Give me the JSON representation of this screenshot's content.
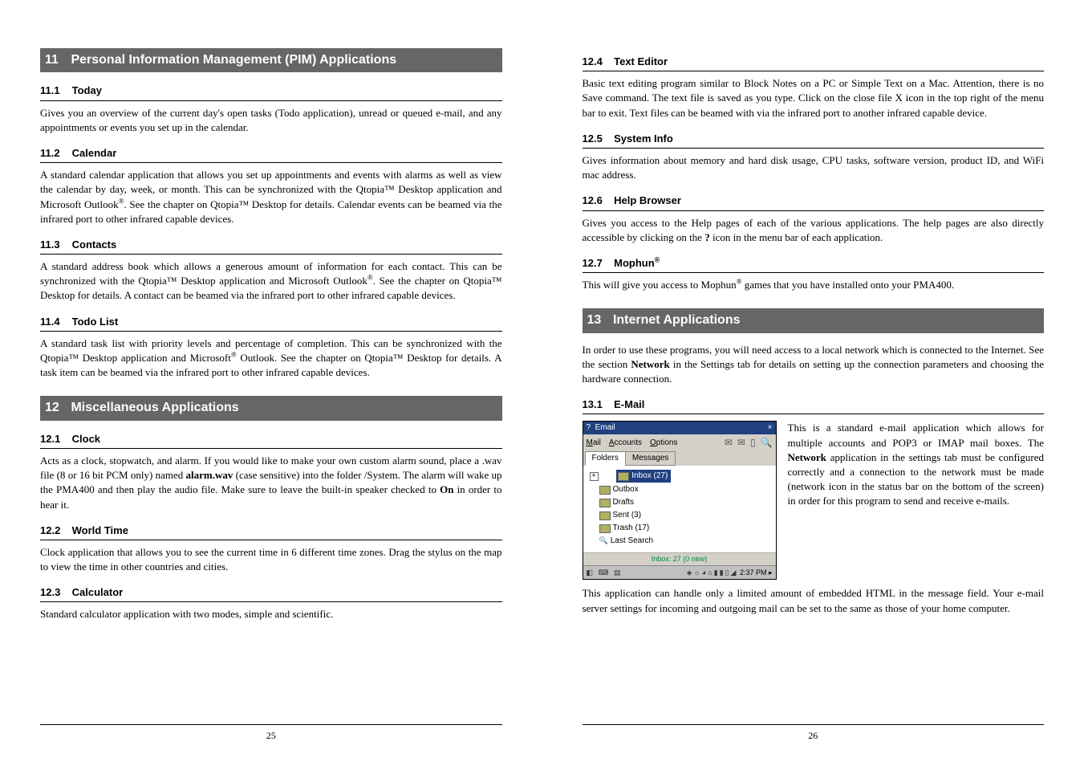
{
  "left": {
    "ch11": {
      "num": "11",
      "title": "Personal Information Management (PIM) Applications",
      "s1": {
        "num": "11.1",
        "title": "Today",
        "body": "Gives you an overview of the current day's open tasks (Todo application), unread or queued e-mail, and any appointments or events you set up in the calendar."
      },
      "s2": {
        "num": "11.2",
        "title": "Calendar",
        "body_pre": "A standard calendar application that allows you set up appointments and events with alarms as well as view the calendar by day, week, or month. This can be synchronized with the Qtopia™ Desktop application and Microsoft Outlook",
        "body_post": ". See the chapter on Qtopia™ Desktop for details. Calendar events can be beamed via the infrared port to other infrared capable devices."
      },
      "s3": {
        "num": "11.3",
        "title": "Contacts",
        "body_pre": "A standard address book which allows a generous amount of information for each contact. This can be synchronized with the Qtopia™ Desktop application and Microsoft Outlook",
        "body_post": ". See the chapter on Qtopia™ Desktop for details. A contact can be beamed via the infrared port to other infrared capable devices."
      },
      "s4": {
        "num": "11.4",
        "title": "Todo List",
        "body_pre": "A standard task list with priority levels and percentage of completion. This can be synchronized with the Qtopia™ Desktop application and Microsoft",
        "body_post": " Outlook. See the chapter on Qtopia™ Desktop for details. A task item can be beamed via the infrared port to other infrared capable devices."
      }
    },
    "ch12": {
      "num": "12",
      "title": "Miscellaneous Applications",
      "s1": {
        "num": "12.1",
        "title": "Clock",
        "body_a": "Acts as a clock, stopwatch, and alarm. If you would like to make your own custom alarm sound, place a .wav file (8 or 16 bit PCM only) named ",
        "body_alarm": "alarm.wav",
        "body_b": " (case sensitive) into the folder /System. The alarm will wake up the PMA400 and then play the audio file. Make sure to leave the built-in speaker checked to ",
        "body_on": "On",
        "body_c": " in order to hear it."
      },
      "s2": {
        "num": "12.2",
        "title": "World Time",
        "body": "Clock application that allows you to see the current time in 6 different time zones. Drag the stylus on the map to view the time in other countries and cities."
      },
      "s3": {
        "num": "12.3",
        "title": "Calculator",
        "body": "Standard calculator application with two modes, simple and scientific."
      }
    },
    "pagenum": "25"
  },
  "right": {
    "s4": {
      "num": "12.4",
      "title": "Text Editor",
      "body": "Basic text editing program similar to Block Notes on a PC or Simple Text on a Mac. Attention, there is no Save command. The text file is saved as you type. Click on the close file X icon in the top right of the menu bar to exit. Text files can be beamed with via the infrared port to another infrared capable device."
    },
    "s5": {
      "num": "12.5",
      "title": "System Info",
      "body": "Gives information about memory and hard disk usage, CPU tasks, software version, product ID, and WiFi mac address."
    },
    "s6": {
      "num": "12.6",
      "title": "Help Browser",
      "body_a": "Gives you access to the Help pages of each of the various applications. The help pages are also directly accessible by clicking on the ",
      "body_q": "?",
      "body_b": " icon in the menu bar of each application."
    },
    "s7": {
      "num": "12.7",
      "title": "Mophun",
      "body_a": "This will give you access to Mophun",
      "body_b": " games that you have installed onto your PMA400."
    },
    "ch13": {
      "num": "13",
      "title": "Internet Applications",
      "intro_a": "In order to use these programs, you will need access to a local network which is connected to the Internet. See the section ",
      "intro_net": "Network",
      "intro_b": " in the Settings tab for details on setting up the connection parameters and choosing the hardware connection.",
      "s1": {
        "num": "13.1",
        "title": "E-Mail",
        "side_a": "This is a standard e-mail application which allows for multiple accounts and POP3 or IMAP mail boxes. The ",
        "side_net": "Network",
        "side_b": " application in the settings tab must be configured correctly and a connection to the network must be made (network icon in the status bar on the bottom of the screen) in order for this program to send and receive e-mails.",
        "after": "This application can handle only a limited amount of embedded HTML in the message field. Your e-mail server settings for incoming and outgoing mail can be set to the same as those of your home computer."
      }
    },
    "pagenum": "26",
    "email_fig": {
      "title": "Email",
      "help": "?",
      "close": "×",
      "menus": [
        "Mail",
        "Accounts",
        "Options"
      ],
      "tabs": [
        "Folders",
        "Messages"
      ],
      "tree": [
        {
          "label": "Inbox (27)",
          "selected": true
        },
        {
          "label": "Outbox"
        },
        {
          "label": "Drafts"
        },
        {
          "label": "Sent (3)"
        },
        {
          "label": "Trash (17)"
        },
        {
          "label": "Last Search",
          "search": true
        }
      ],
      "status": "Inbox: 27 (0 new)",
      "time": "2:37 PM"
    }
  }
}
